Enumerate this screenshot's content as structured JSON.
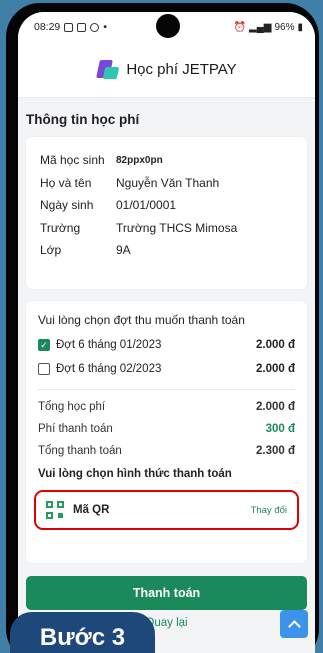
{
  "status_bar": {
    "time": "08:29",
    "battery": "96%"
  },
  "header": {
    "app_title": "Học phí JETPAY"
  },
  "section_title": "Thông tin học phí",
  "student": [
    {
      "label": "Mã học sinh",
      "value": "82ppx0pn"
    },
    {
      "label": "Họ và tên",
      "value": "Nguyễn Văn Thanh"
    },
    {
      "label": "Ngày sinh",
      "value": "01/01/0001"
    },
    {
      "label": "Trường",
      "value": "Trường THCS Mimosa"
    },
    {
      "label": "Lớp",
      "value": "9A"
    }
  ],
  "payment": {
    "choose_period_label": "Vui lòng chọn đợt thu muốn thanh toán",
    "periods": [
      {
        "label": "Đợt 6 tháng 01/2023",
        "amount": "2.000 đ",
        "checked": true
      },
      {
        "label": "Đợt 6 tháng 02/2023",
        "amount": "2.000 đ",
        "checked": false
      }
    ],
    "total_label": "Tổng học phí",
    "total_value": "2.000 đ",
    "fee_label": "Phí thanh toán",
    "fee_value": "300 đ",
    "grand_label": "Tổng thanh toán",
    "grand_value": "2.300 đ",
    "method_prompt": "Vui lòng chọn hình thức thanh toán",
    "method_name": "Mã QR",
    "change_label": "Thay đổi"
  },
  "actions": {
    "pay": "Thanh toán",
    "back": "Quay lại"
  },
  "step_badge": "Bước 3",
  "colors": {
    "accent": "#1b8a5a",
    "highlight": "#e00000",
    "badge": "#1e477a",
    "background": "#3f7fa8"
  }
}
